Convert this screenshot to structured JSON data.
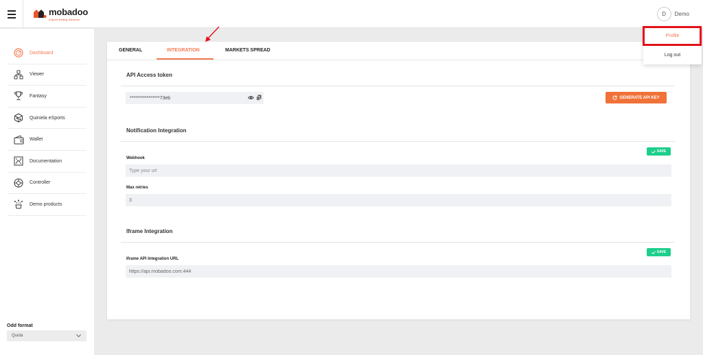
{
  "header": {
    "logo_name": "mobadoo",
    "logo_tagline": "eSports Betting Solutions",
    "user_initial": "D",
    "user_name": "Demo"
  },
  "dropdown": {
    "profile": "Profile",
    "logout": "Log out"
  },
  "sidebar": {
    "items": [
      {
        "label": "Dashboard",
        "icon": "dashboard-icon",
        "active": true
      },
      {
        "label": "Viewer",
        "icon": "viewer-icon"
      },
      {
        "label": "Fantasy",
        "icon": "trophy-icon"
      },
      {
        "label": "Quiniela eSports",
        "icon": "cube-icon"
      },
      {
        "label": "Wallet",
        "icon": "wallet-icon"
      },
      {
        "label": "Documentation",
        "icon": "documentation-icon"
      },
      {
        "label": "Controller",
        "icon": "controller-icon"
      },
      {
        "label": "Demo products",
        "icon": "demo-products-icon"
      }
    ],
    "odd_format_label": "Odd format",
    "odd_format_value": "Quota"
  },
  "tabs": [
    {
      "label": "GENERAL"
    },
    {
      "label": "INTEGRATION",
      "active": true
    },
    {
      "label": "MARKETS SPREAD"
    }
  ],
  "api": {
    "title": "API Access token",
    "token_value": "****************73eb",
    "generate_label": "GENERATE API KEY"
  },
  "notification": {
    "title": "Notification Integration",
    "save_label": "SAVE",
    "webhook_label": "Webhook",
    "webhook_placeholder": "Type your url",
    "retries_label": "Max retries",
    "retries_value": "3"
  },
  "iframe": {
    "title": "Iframe Integration",
    "save_label": "SAVE",
    "url_label": "Iframe API Integration URL",
    "url_value": "https://api.mobadoo.com:444"
  },
  "colors": {
    "accent": "#f47a50",
    "button": "#f07238",
    "save": "#1ecf8c",
    "highlight": "#e3101a"
  }
}
